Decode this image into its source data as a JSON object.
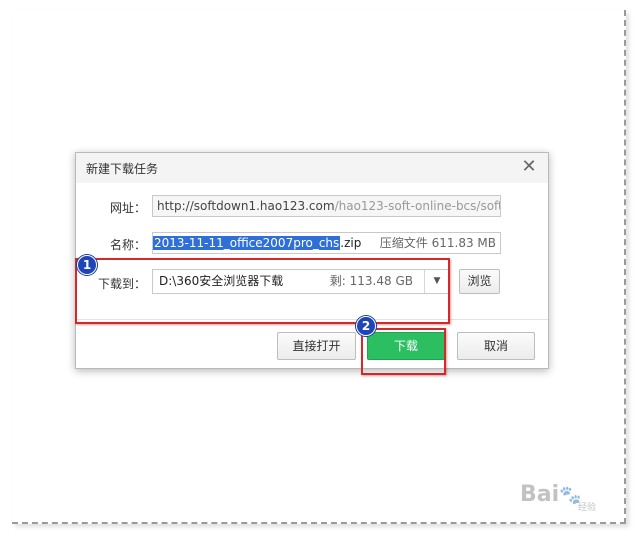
{
  "dialog": {
    "title": "新建下载任务",
    "close_glyph": "✕",
    "url_label": "网址：",
    "url_host": "http://softdown1.hao123.com",
    "url_path": "/hao123-soft-online-bcs/soft/",
    "name_label": "名称：",
    "name_selected": "2013-11-11_office2007pro_chs",
    "name_ext": ".zip",
    "file_type": "压缩文件 611.83 MB",
    "save_label": "下载到：",
    "save_path": "D:\\360安全浏览器下载",
    "free_space": "剩: 113.48 GB",
    "dropdown_glyph": "▼",
    "browse_label": "浏览",
    "open_label": "直接打开",
    "download_label": "下载",
    "cancel_label": "取消"
  },
  "annotations": {
    "badge1": "1",
    "badge2": "2",
    "highlight_color": "#d22a2a",
    "badge_color": "#1f46b8"
  },
  "watermark": {
    "brand": "Bai du",
    "sub": "经验"
  },
  "colors": {
    "accent": "#2cbf62",
    "selection": "#2f70d8"
  }
}
